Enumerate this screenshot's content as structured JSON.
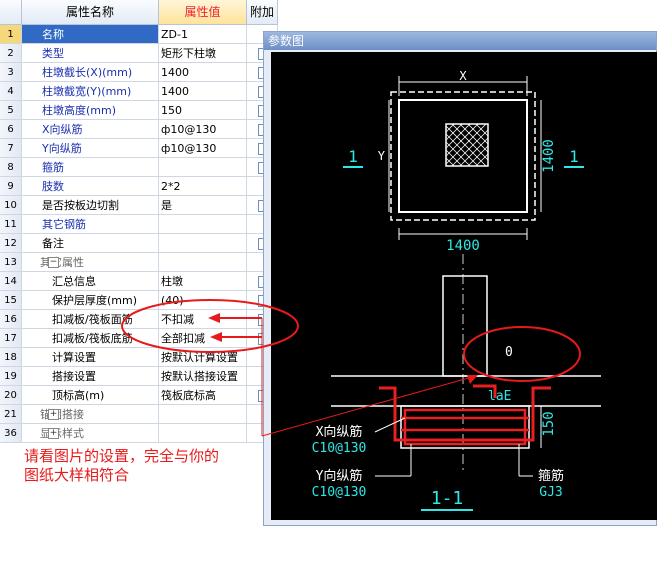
{
  "table": {
    "header": {
      "name": "属性名称",
      "value": "属性值",
      "extra": "附加"
    },
    "rows": [
      {
        "num": "1",
        "name": "名称",
        "value": "ZD-1",
        "style": "blue",
        "check": false,
        "selected": true
      },
      {
        "num": "2",
        "name": "类型",
        "value": "矩形下柱墩",
        "style": "blue",
        "check": true
      },
      {
        "num": "3",
        "name": "柱墩截长(X)(mm)",
        "value": "1400",
        "style": "blue",
        "check": true
      },
      {
        "num": "4",
        "name": "柱墩截宽(Y)(mm)",
        "value": "1400",
        "style": "blue",
        "check": true
      },
      {
        "num": "5",
        "name": "柱墩高度(mm)",
        "value": "150",
        "style": "blue",
        "check": true
      },
      {
        "num": "6",
        "name": "X向纵筋",
        "value": "ф10@130",
        "style": "blue",
        "check": true
      },
      {
        "num": "7",
        "name": "Y向纵筋",
        "value": "ф10@130",
        "style": "blue",
        "check": true
      },
      {
        "num": "8",
        "name": "箍筋",
        "value": "",
        "style": "blue",
        "check": true
      },
      {
        "num": "9",
        "name": "肢数",
        "value": "2*2",
        "style": "blue",
        "check": false
      },
      {
        "num": "10",
        "name": "是否按板边切割",
        "value": "是",
        "style": "normal",
        "check": true
      },
      {
        "num": "11",
        "name": "其它钢筋",
        "value": "",
        "style": "blue",
        "check": false
      },
      {
        "num": "12",
        "name": "备注",
        "value": "",
        "style": "normal",
        "check": true
      },
      {
        "num": "13",
        "name": "其它属性",
        "value": "",
        "style": "group",
        "expander": "−"
      },
      {
        "num": "14",
        "name": "汇总信息",
        "value": "柱墩",
        "style": "sub",
        "check": true
      },
      {
        "num": "15",
        "name": "保护层厚度(mm)",
        "value": "(40)",
        "style": "sub",
        "check": true
      },
      {
        "num": "16",
        "name": "扣减板/筏板面筋",
        "value": "不扣减",
        "style": "sub",
        "check": true
      },
      {
        "num": "17",
        "name": "扣减板/筏板底筋",
        "value": "全部扣减",
        "style": "sub",
        "check": true
      },
      {
        "num": "18",
        "name": "计算设置",
        "value": "按默认计算设置",
        "style": "sub",
        "check": false
      },
      {
        "num": "19",
        "name": "搭接设置",
        "value": "按默认搭接设置",
        "style": "sub",
        "check": false
      },
      {
        "num": "20",
        "name": "顶标高(m)",
        "value": "筏板底标高",
        "style": "sub",
        "check": true
      },
      {
        "num": "21",
        "name": "锚固搭接",
        "value": "",
        "style": "group",
        "expander": "+"
      },
      {
        "num": "36",
        "name": "显示样式",
        "value": "",
        "style": "group",
        "expander": "+"
      }
    ]
  },
  "ref_panel": {
    "title": "参数图",
    "labels": {
      "x": "X",
      "y": "Y",
      "dim_x": "1400",
      "dim_y": "1400",
      "sec_left": "1",
      "sec_right": "1",
      "zero": "0",
      "lae": "laE",
      "dim_h": "150",
      "x_bar": "X向纵筋",
      "x_bar_spec": "C10@130",
      "y_bar": "Y向纵筋",
      "y_bar_spec": "C10@130",
      "stirrup": "箍筋",
      "stirrup_spec": "GJ3",
      "section": "1-1"
    }
  },
  "annotation": {
    "line1": "请看图片的设置，完全与你的",
    "line2": "图纸大样相符合",
    "color": "#e61a1a"
  }
}
